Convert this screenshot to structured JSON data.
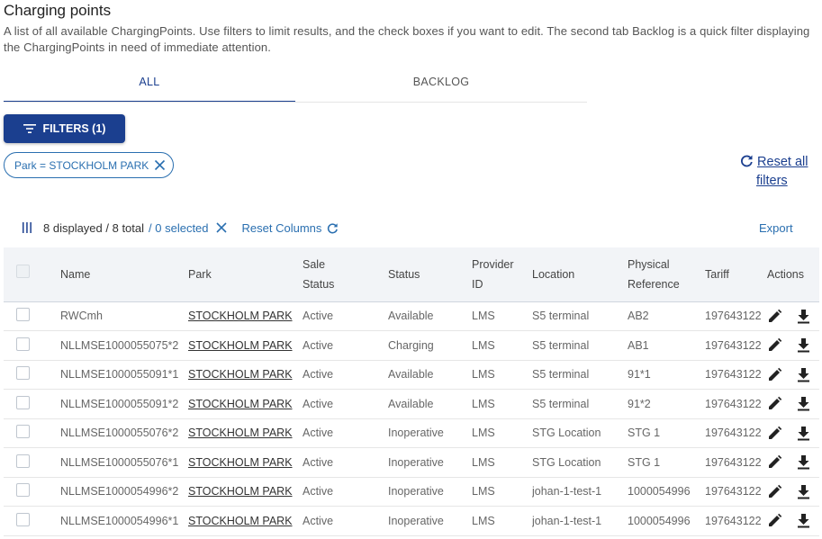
{
  "page": {
    "title": "Charging points",
    "description": "A list of all available ChargingPoints. Use filters to limit results, and the check boxes if you want to edit. The second tab Backlog is a quick filter displaying the ChargingPoints in need of immediate attention."
  },
  "tabs": {
    "all": "ALL",
    "backlog": "BACKLOG"
  },
  "filters": {
    "button_label": "FILTERS (1)",
    "chip_label": "Park = STOCKHOLM PARK",
    "reset_all_line1": "Reset all",
    "reset_all_line2": "filters"
  },
  "toolbar": {
    "displayed": "8 displayed / 8 total",
    "selected": "/ 0 selected",
    "reset_columns": "Reset Columns",
    "export": "Export"
  },
  "table": {
    "headers": {
      "name": "Name",
      "park": "Park",
      "sale_status_1": "Sale",
      "sale_status_2": "Status",
      "status": "Status",
      "provider_1": "Provider",
      "provider_2": "ID",
      "location": "Location",
      "physical_1": "Physical",
      "physical_2": "Reference",
      "tariff": "Tariff",
      "actions": "Actions"
    },
    "rows": [
      {
        "name": "RWCmh",
        "park": "STOCKHOLM PARK",
        "sale_status": "Active",
        "status": "Available",
        "provider": "LMS",
        "location": "S5 terminal",
        "physical": "AB2",
        "tariff": "197643122"
      },
      {
        "name": "NLLMSE1000055075*2",
        "park": "STOCKHOLM PARK",
        "sale_status": "Active",
        "status": "Charging",
        "provider": "LMS",
        "location": "S5 terminal",
        "physical": "AB1",
        "tariff": "197643122"
      },
      {
        "name": "NLLMSE1000055091*1",
        "park": "STOCKHOLM PARK",
        "sale_status": "Active",
        "status": "Available",
        "provider": "LMS",
        "location": "S5 terminal",
        "physical": "91*1",
        "tariff": "197643122"
      },
      {
        "name": "NLLMSE1000055091*2",
        "park": "STOCKHOLM PARK",
        "sale_status": "Active",
        "status": "Available",
        "provider": "LMS",
        "location": "S5 terminal",
        "physical": "91*2",
        "tariff": "197643122"
      },
      {
        "name": "NLLMSE1000055076*2",
        "park": "STOCKHOLM PARK",
        "sale_status": "Active",
        "status": "Inoperative",
        "provider": "LMS",
        "location": "STG Location",
        "physical": "STG 1",
        "tariff": "197643122"
      },
      {
        "name": "NLLMSE1000055076*1",
        "park": "STOCKHOLM PARK",
        "sale_status": "Active",
        "status": "Inoperative",
        "provider": "LMS",
        "location": "STG Location",
        "physical": "STG 1",
        "tariff": "197643122"
      },
      {
        "name": "NLLMSE1000054996*2",
        "park": "STOCKHOLM PARK",
        "sale_status": "Active",
        "status": "Inoperative",
        "provider": "LMS",
        "location": "johan-1-test-1",
        "physical": "1000054996",
        "tariff": "197643122"
      },
      {
        "name": "NLLMSE1000054996*1",
        "park": "STOCKHOLM PARK",
        "sale_status": "Active",
        "status": "Inoperative",
        "provider": "LMS",
        "location": "johan-1-test-1",
        "physical": "1000054996",
        "tariff": "197643122"
      }
    ]
  },
  "icons": {
    "filter": "filter-lines-icon",
    "close": "close-icon",
    "refresh": "refresh-icon",
    "columns": "columns-icon",
    "edit": "pencil-icon",
    "download": "download-icon"
  },
  "colors": {
    "primary": "#1b3f8f",
    "link": "#2a6fb0",
    "header_bg": "#f2f4f7"
  }
}
